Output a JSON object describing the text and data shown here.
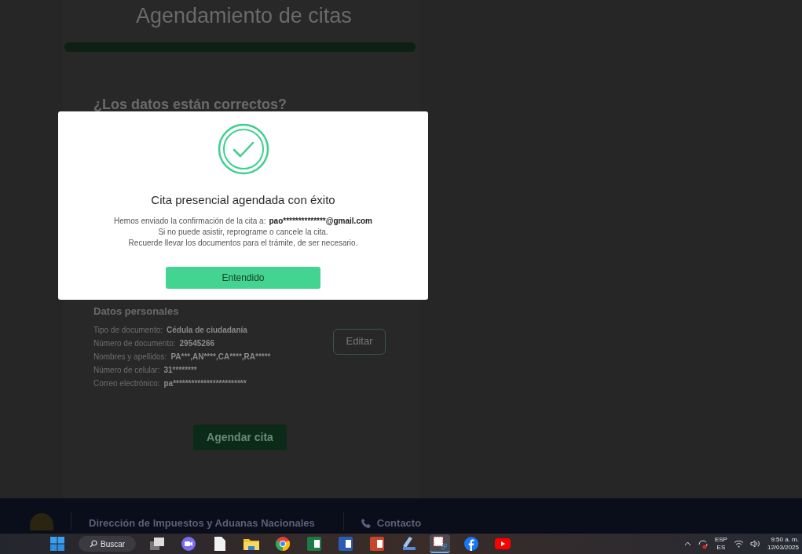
{
  "page": {
    "title": "Agendamiento de citas",
    "progress": {
      "level": 1
    },
    "question": "¿Los datos están correctos?",
    "section_title": "Datos personales",
    "fields": [
      {
        "label": "Tipo de documento:",
        "value": "Cédula de ciudadanía"
      },
      {
        "label": "Número de documento:",
        "value": "29545266"
      },
      {
        "label": "Nombres y apellidos:",
        "value": "PA***,AN****,CA****,RA*****"
      },
      {
        "label": "Número de celular:",
        "value": "31********"
      },
      {
        "label": "Correo electrónico:",
        "value": "pa************************"
      }
    ],
    "edit_button": "Editar",
    "submit_button": "Agendar cita"
  },
  "footer": {
    "organization": "Dirección de Impuestos y Aduanas Nacionales",
    "contact": "Contacto"
  },
  "modal": {
    "title": "Cita presencial agendada con éxito",
    "recipient_label": "Hemos enviado la confirmación de la cita a:",
    "recipient": "pao**************@gmail.com",
    "lines": [
      "Si no puede asistir, reprograme o cancele la cita.",
      "Recuerde llevar los documentos para el trámite, de ser necesario."
    ],
    "button": "Entendido"
  },
  "taskbar": {
    "search": "Buscar",
    "apps": [
      {
        "kind": "windows",
        "selected": false
      },
      {
        "kind": "taskview",
        "selected": false
      },
      {
        "kind": "chat",
        "selected": false
      },
      {
        "kind": "notepad",
        "selected": false
      },
      {
        "kind": "folder",
        "selected": false
      },
      {
        "kind": "chrome",
        "selected": false
      },
      {
        "kind": "excel",
        "selected": false
      },
      {
        "kind": "word",
        "selected": false
      },
      {
        "kind": "powerpoint",
        "selected": false
      },
      {
        "kind": "scanner",
        "selected": false
      },
      {
        "kind": "snip",
        "selected": true
      },
      {
        "kind": "facebook",
        "selected": false
      },
      {
        "kind": "youtube",
        "selected": false
      }
    ],
    "language": "ESP",
    "layout": "ES",
    "time": "9:50 a. m.",
    "date": "12/03/2025"
  }
}
